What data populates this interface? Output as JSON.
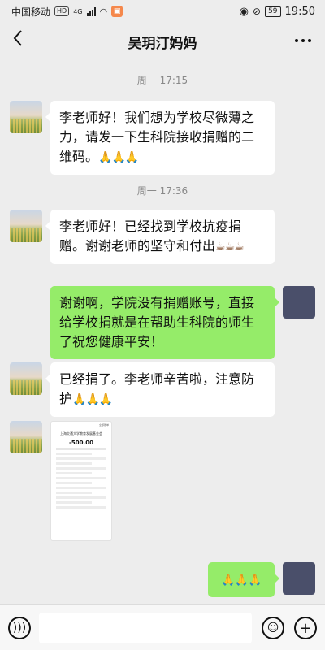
{
  "status_bar": {
    "carrier": "中国移动",
    "hd": "HD",
    "network": "4G",
    "battery": "59",
    "time": "19:50"
  },
  "header": {
    "title": "吴玥汀妈妈",
    "back_icon": "chevron-left-icon",
    "more_icon": "more-icon"
  },
  "chat": {
    "timestamps": [
      "周一 17:15",
      "周一 17:36"
    ],
    "messages": [
      {
        "sender": "other",
        "text": "李老师好！我们想为学校尽微薄之力，请发一下生科院接收捐赠的二维码。",
        "emoji": "🙏🙏🙏"
      },
      {
        "sender": "other",
        "text": "李老师好！已经找到学校抗疫捐赠。谢谢老师的坚守和付出",
        "emoji": "☕☕☕"
      },
      {
        "sender": "self",
        "text": "谢谢啊，学院没有捐赠账号，直接给学校捐就是在帮助生科院的师生了祝您健康平安！"
      },
      {
        "sender": "other",
        "text": "已经捐了。李老师辛苦啦，注意防护",
        "emoji": "🙏🙏🙏"
      },
      {
        "sender": "other",
        "image": {
          "top": "全部账单",
          "payee": "上海交通大学教育发展基金会",
          "amount": "-500.00"
        }
      },
      {
        "sender": "self",
        "emoji": "🙏🙏🙏"
      }
    ]
  },
  "input_bar": {
    "voice_icon": "voice-icon",
    "emoji_icon": "emoji-icon",
    "add_icon": "plus-icon"
  }
}
